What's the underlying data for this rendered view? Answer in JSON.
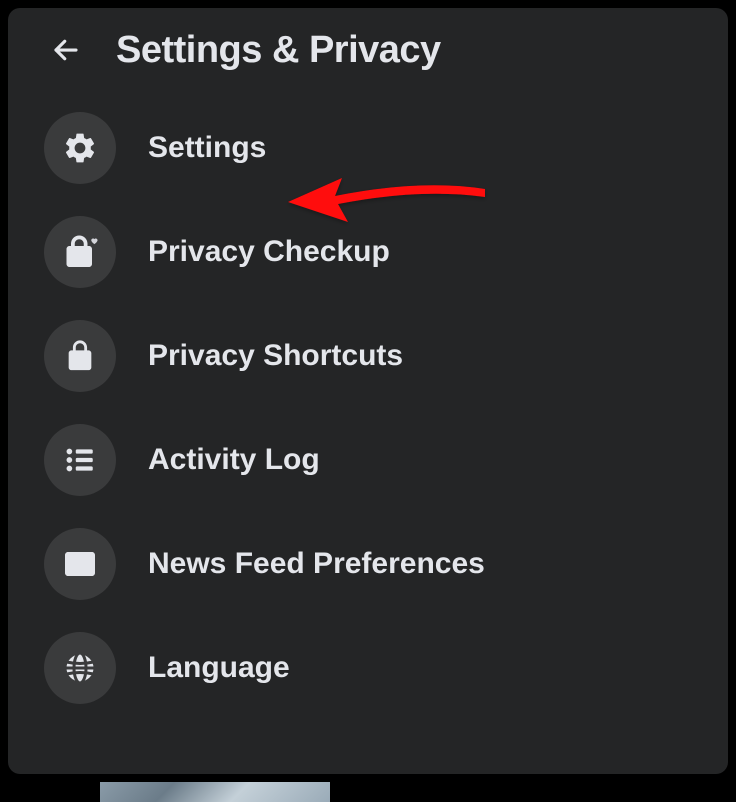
{
  "header": {
    "title": "Settings & Privacy"
  },
  "menu": {
    "items": [
      {
        "label": "Settings",
        "icon": "gear"
      },
      {
        "label": "Privacy Checkup",
        "icon": "lock-heart"
      },
      {
        "label": "Privacy Shortcuts",
        "icon": "lock"
      },
      {
        "label": "Activity Log",
        "icon": "list"
      },
      {
        "label": "News Feed Preferences",
        "icon": "newspaper"
      },
      {
        "label": "Language",
        "icon": "globe"
      }
    ]
  },
  "annotation": {
    "type": "arrow",
    "color": "#ff0000",
    "target": "Settings"
  }
}
